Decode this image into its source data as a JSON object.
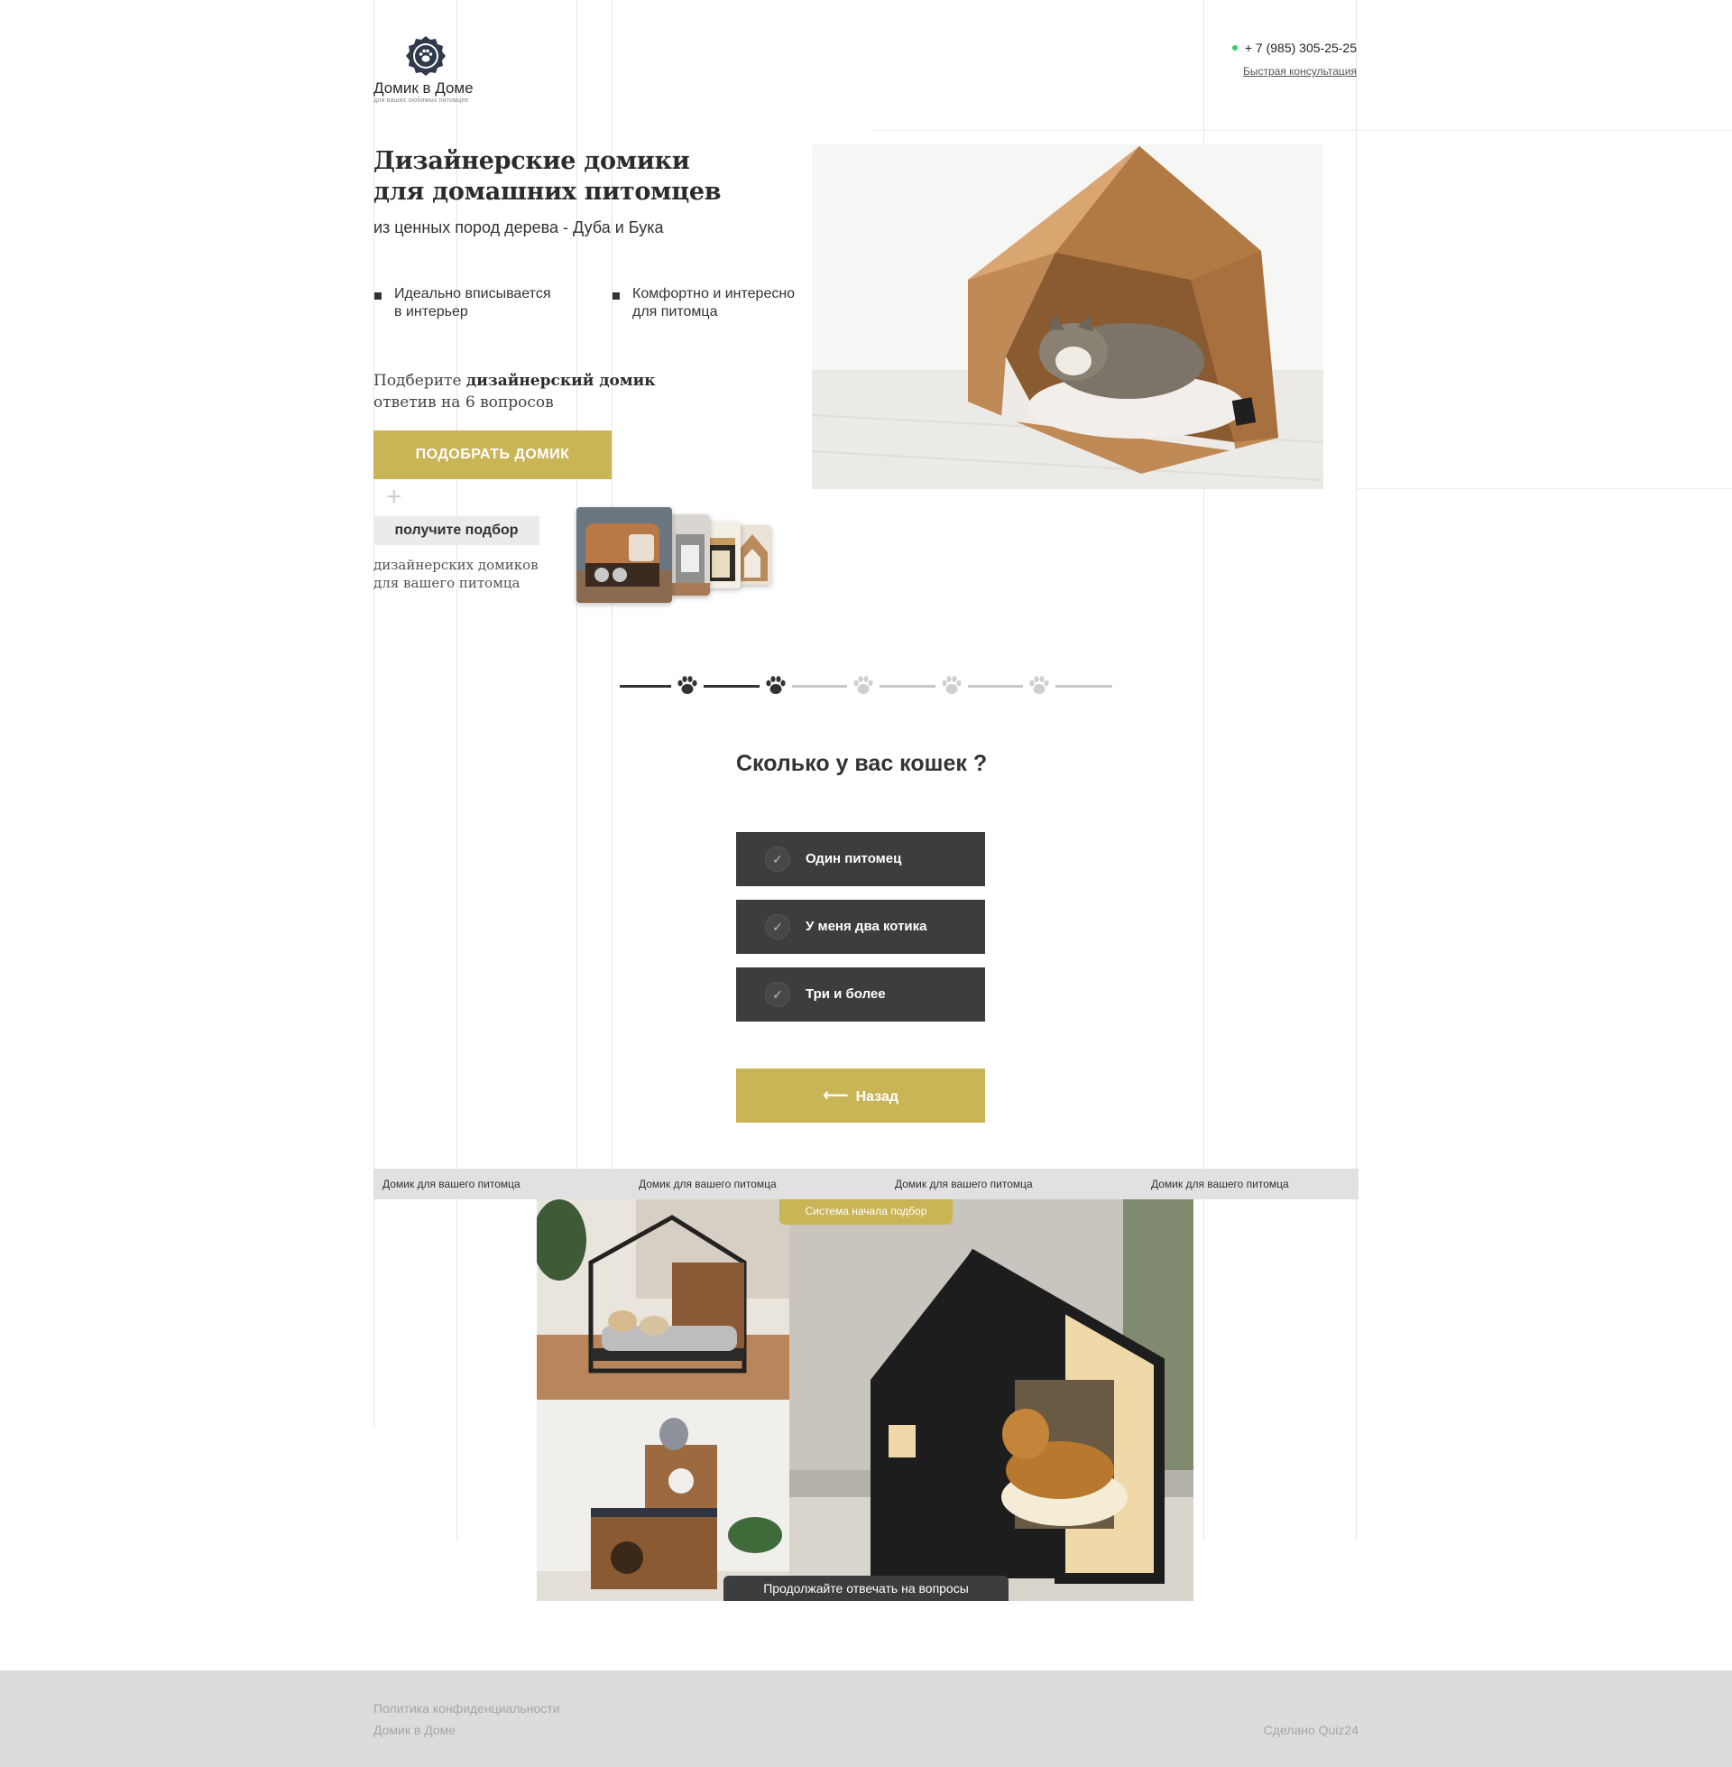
{
  "header": {
    "logo_name": "Домик в Доме",
    "logo_tagline": "для ваших любимых питомцев",
    "phone": "+ 7 (985) 305-25-25",
    "consult_link": "Быстрая консультация"
  },
  "hero": {
    "title_line1": "Дизайнерские домики",
    "title_line2": "для домашних питомцев",
    "subtitle": "из ценных пород дерева - Дуба и Бука",
    "features": [
      {
        "line1": "Идеально вписывается",
        "line2": "в интерьер"
      },
      {
        "line1": "Комфортно и интересно",
        "line2": "для питомца"
      }
    ],
    "pick_text_pre": "Подберите ",
    "pick_text_bold": "дизайнерский домик",
    "pick_text_line2": "ответив на 6 вопросов",
    "pick_button": "ПОДОБРАТЬ ДОМИК",
    "plus": "+",
    "get_chip": "получите подбор",
    "get_sub_line1": "дизайнерских домиков",
    "get_sub_line2": "для вашего питомца"
  },
  "quiz": {
    "progress": {
      "total_steps": 5,
      "completed_steps": 2
    },
    "question": "Сколько у вас кошек ?",
    "answers": [
      "Один питомец",
      "У меня два котика",
      "Три и более"
    ],
    "check_glyph": "✓",
    "back_arrow": "⟵",
    "back_button": "Назад"
  },
  "band": {
    "items": [
      "Домик для вашего питомца",
      "Домик для вашего питомца",
      "Домик для вашего питомца",
      "Домик для вашего питомца"
    ]
  },
  "gallery": {
    "chip_top": "Система начала подбор",
    "chip_bottom": "Продолжайте отвечать на вопросы"
  },
  "footer": {
    "privacy": "Политика конфиденциальности",
    "brand": "Домик в Доме",
    "made_by": "Сделано Quiz24"
  },
  "colors": {
    "accent_gold": "#c9b456",
    "dark": "#3d3d3d",
    "footer_bg": "#dcdcdc",
    "status_dot": "#2ecc71"
  }
}
